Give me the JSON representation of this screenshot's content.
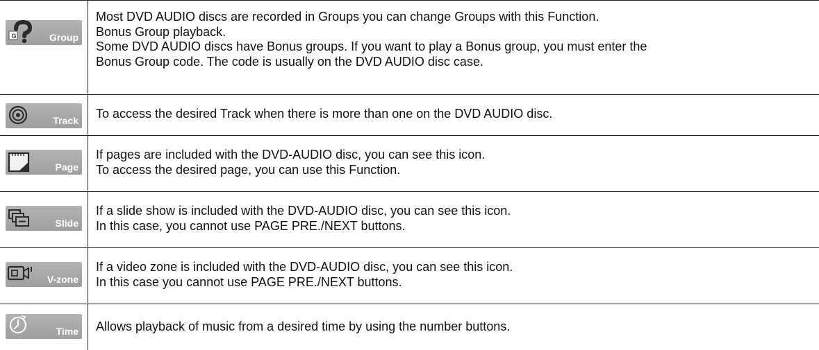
{
  "functions": [
    {
      "icon": "group-icon",
      "icon_label": "Group",
      "lines": [
        "Most DVD AUDIO discs are recorded in Groups you can change Groups with this Function.",
        "Bonus Group playback.",
        "Some DVD AUDIO discs have Bonus groups. If you want to play a Bonus group, you must enter the",
        "Bonus Group code. The code is usually on the DVD AUDIO disc case."
      ]
    },
    {
      "icon": "track-icon",
      "icon_label": "Track",
      "lines": [
        "To access the desired Track when there is more than one on the DVD AUDIO disc."
      ]
    },
    {
      "icon": "page-icon",
      "icon_label": "Page",
      "lines": [
        "If pages are included with the DVD-AUDIO disc, you can see this icon.",
        "To access the desired page, you can use this Function."
      ]
    },
    {
      "icon": "slide-icon",
      "icon_label": "Slide",
      "lines": [
        "If a slide show is included with the DVD-AUDIO disc, you can see this icon.",
        "In this case, you cannot use PAGE PRE./NEXT buttons."
      ]
    },
    {
      "icon": "v-zone-icon",
      "icon_label": "V-zone",
      "lines": [
        "If a video zone is included with the DVD-AUDIO disc, you can see this icon.",
        "In this case you cannot use PAGE PRE./NEXT buttons."
      ]
    },
    {
      "icon": "time-icon",
      "icon_label": "Time",
      "lines": [
        "Allows playback of music from a desired time by using the number buttons."
      ]
    }
  ]
}
